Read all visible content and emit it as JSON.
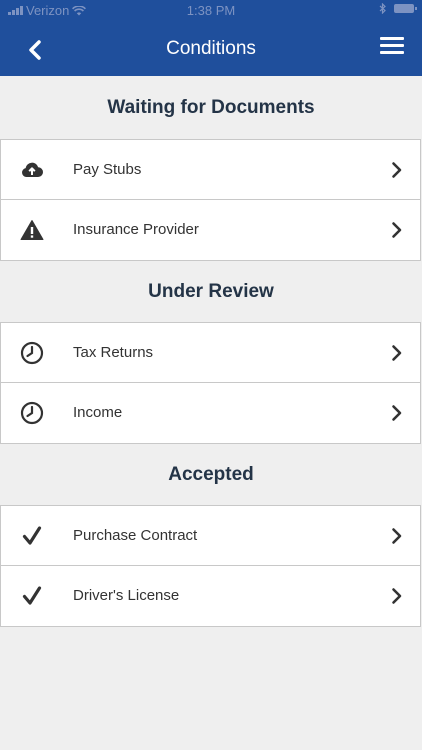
{
  "status_bar": {
    "carrier": "Verizon",
    "time": "1:38 PM"
  },
  "navbar": {
    "title": "Conditions",
    "back_icon": "chevron-left-icon",
    "menu_icon": "hamburger-menu-icon"
  },
  "sections": [
    {
      "title": "Waiting for Documents",
      "items": [
        {
          "label": "Pay Stubs",
          "icon": "cloud-upload-icon"
        },
        {
          "label": "Insurance Provider",
          "icon": "warning-icon"
        }
      ]
    },
    {
      "title": "Under Review",
      "items": [
        {
          "label": "Tax Returns",
          "icon": "clock-icon"
        },
        {
          "label": "Income",
          "icon": "clock-icon"
        }
      ]
    },
    {
      "title": "Accepted",
      "items": [
        {
          "label": "Purchase Contract",
          "icon": "checkmark-icon"
        },
        {
          "label": "Driver's License",
          "icon": "checkmark-icon"
        }
      ]
    }
  ],
  "colors": {
    "header": "#1f4f9c",
    "background": "#efefef",
    "section_title": "#243447"
  }
}
